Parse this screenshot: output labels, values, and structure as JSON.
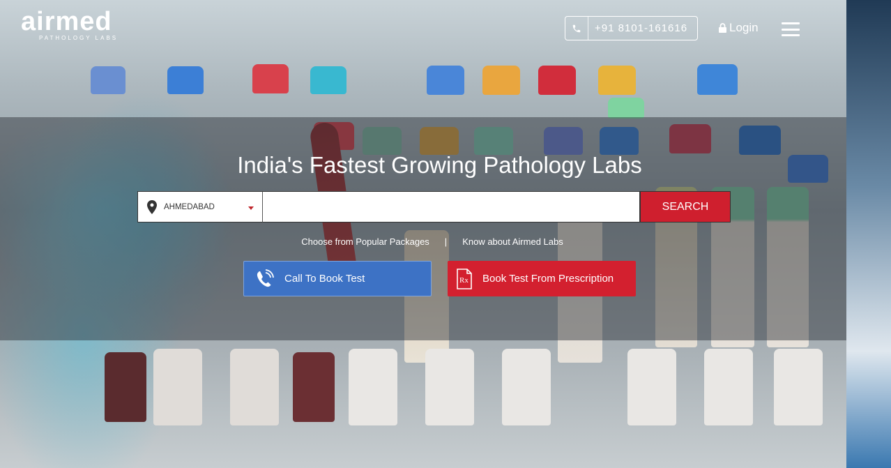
{
  "brand": {
    "name": "airmed",
    "tagline": "PATHOLOGY LABS"
  },
  "header": {
    "phone": "+91 8101-161616",
    "login_label": "Login"
  },
  "hero": {
    "headline": "India's Fastest Growing Pathology Labs"
  },
  "search": {
    "city": "AHMEDABAD",
    "button_label": "SEARCH",
    "query": ""
  },
  "links": {
    "popular": "Choose from Popular Packages",
    "separator": "|",
    "about": "Know about Airmed Labs"
  },
  "actions": {
    "call_label": "Call To Book Test",
    "prescription_label": "Book Test From Prescription",
    "rx_glyph": "Rx"
  },
  "colors": {
    "accent_red": "#cf1f2e",
    "call_blue": "#3d72c5"
  },
  "icons": [
    "phone-icon",
    "lock-icon",
    "menu-icon",
    "location-pin-icon",
    "phone-call-icon",
    "prescription-icon"
  ]
}
